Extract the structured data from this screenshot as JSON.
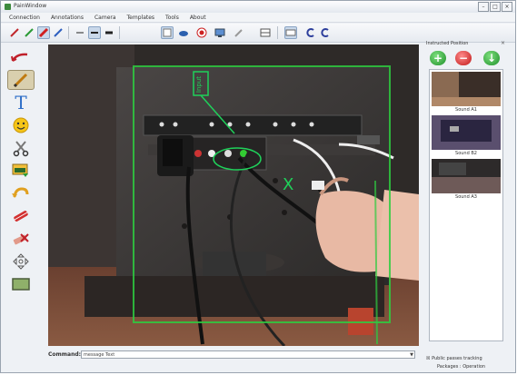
{
  "window": {
    "title": "PainWindow"
  },
  "menu": [
    "Connection",
    "Annotations",
    "Camera",
    "Templates",
    "Tools",
    "About"
  ],
  "toolbar": {
    "buttons": [
      "pen-red-icon",
      "pen-green-icon",
      "pen-highlight-icon",
      "pen-blue-icon",
      "line-small-icon",
      "line-medium-icon",
      "line-large-icon",
      "select-icon",
      "eraser-icon",
      "record-icon",
      "screen-icon",
      "pencil-icon",
      "grid-icon",
      "rectangle-icon",
      "undo-icon",
      "redo-icon"
    ]
  },
  "left_tools": [
    "arrow-tool-icon",
    "pencil-tool-icon",
    "text-tool-icon",
    "smiley-icon",
    "scissors-icon",
    "image-icon",
    "undo-arrow-icon",
    "eraser-tool-icon",
    "clear-icon",
    "move-icon",
    "background-icon"
  ],
  "canvas": {
    "label_tag": "Input",
    "cross_mark": "X"
  },
  "command": {
    "label": "Command:",
    "value": "message Text"
  },
  "right_panel": {
    "header": "Instructed Position",
    "thumbnails": [
      {
        "caption": "Sound A1"
      },
      {
        "caption": "Sound B2"
      },
      {
        "caption": "Sound A3"
      }
    ]
  },
  "footer": {
    "checkbox_label": "Public passes tracking",
    "status": "Packages : Operation"
  },
  "colors": {
    "accent_green": "#1fd15a",
    "frame_green": "#2ecc40"
  }
}
